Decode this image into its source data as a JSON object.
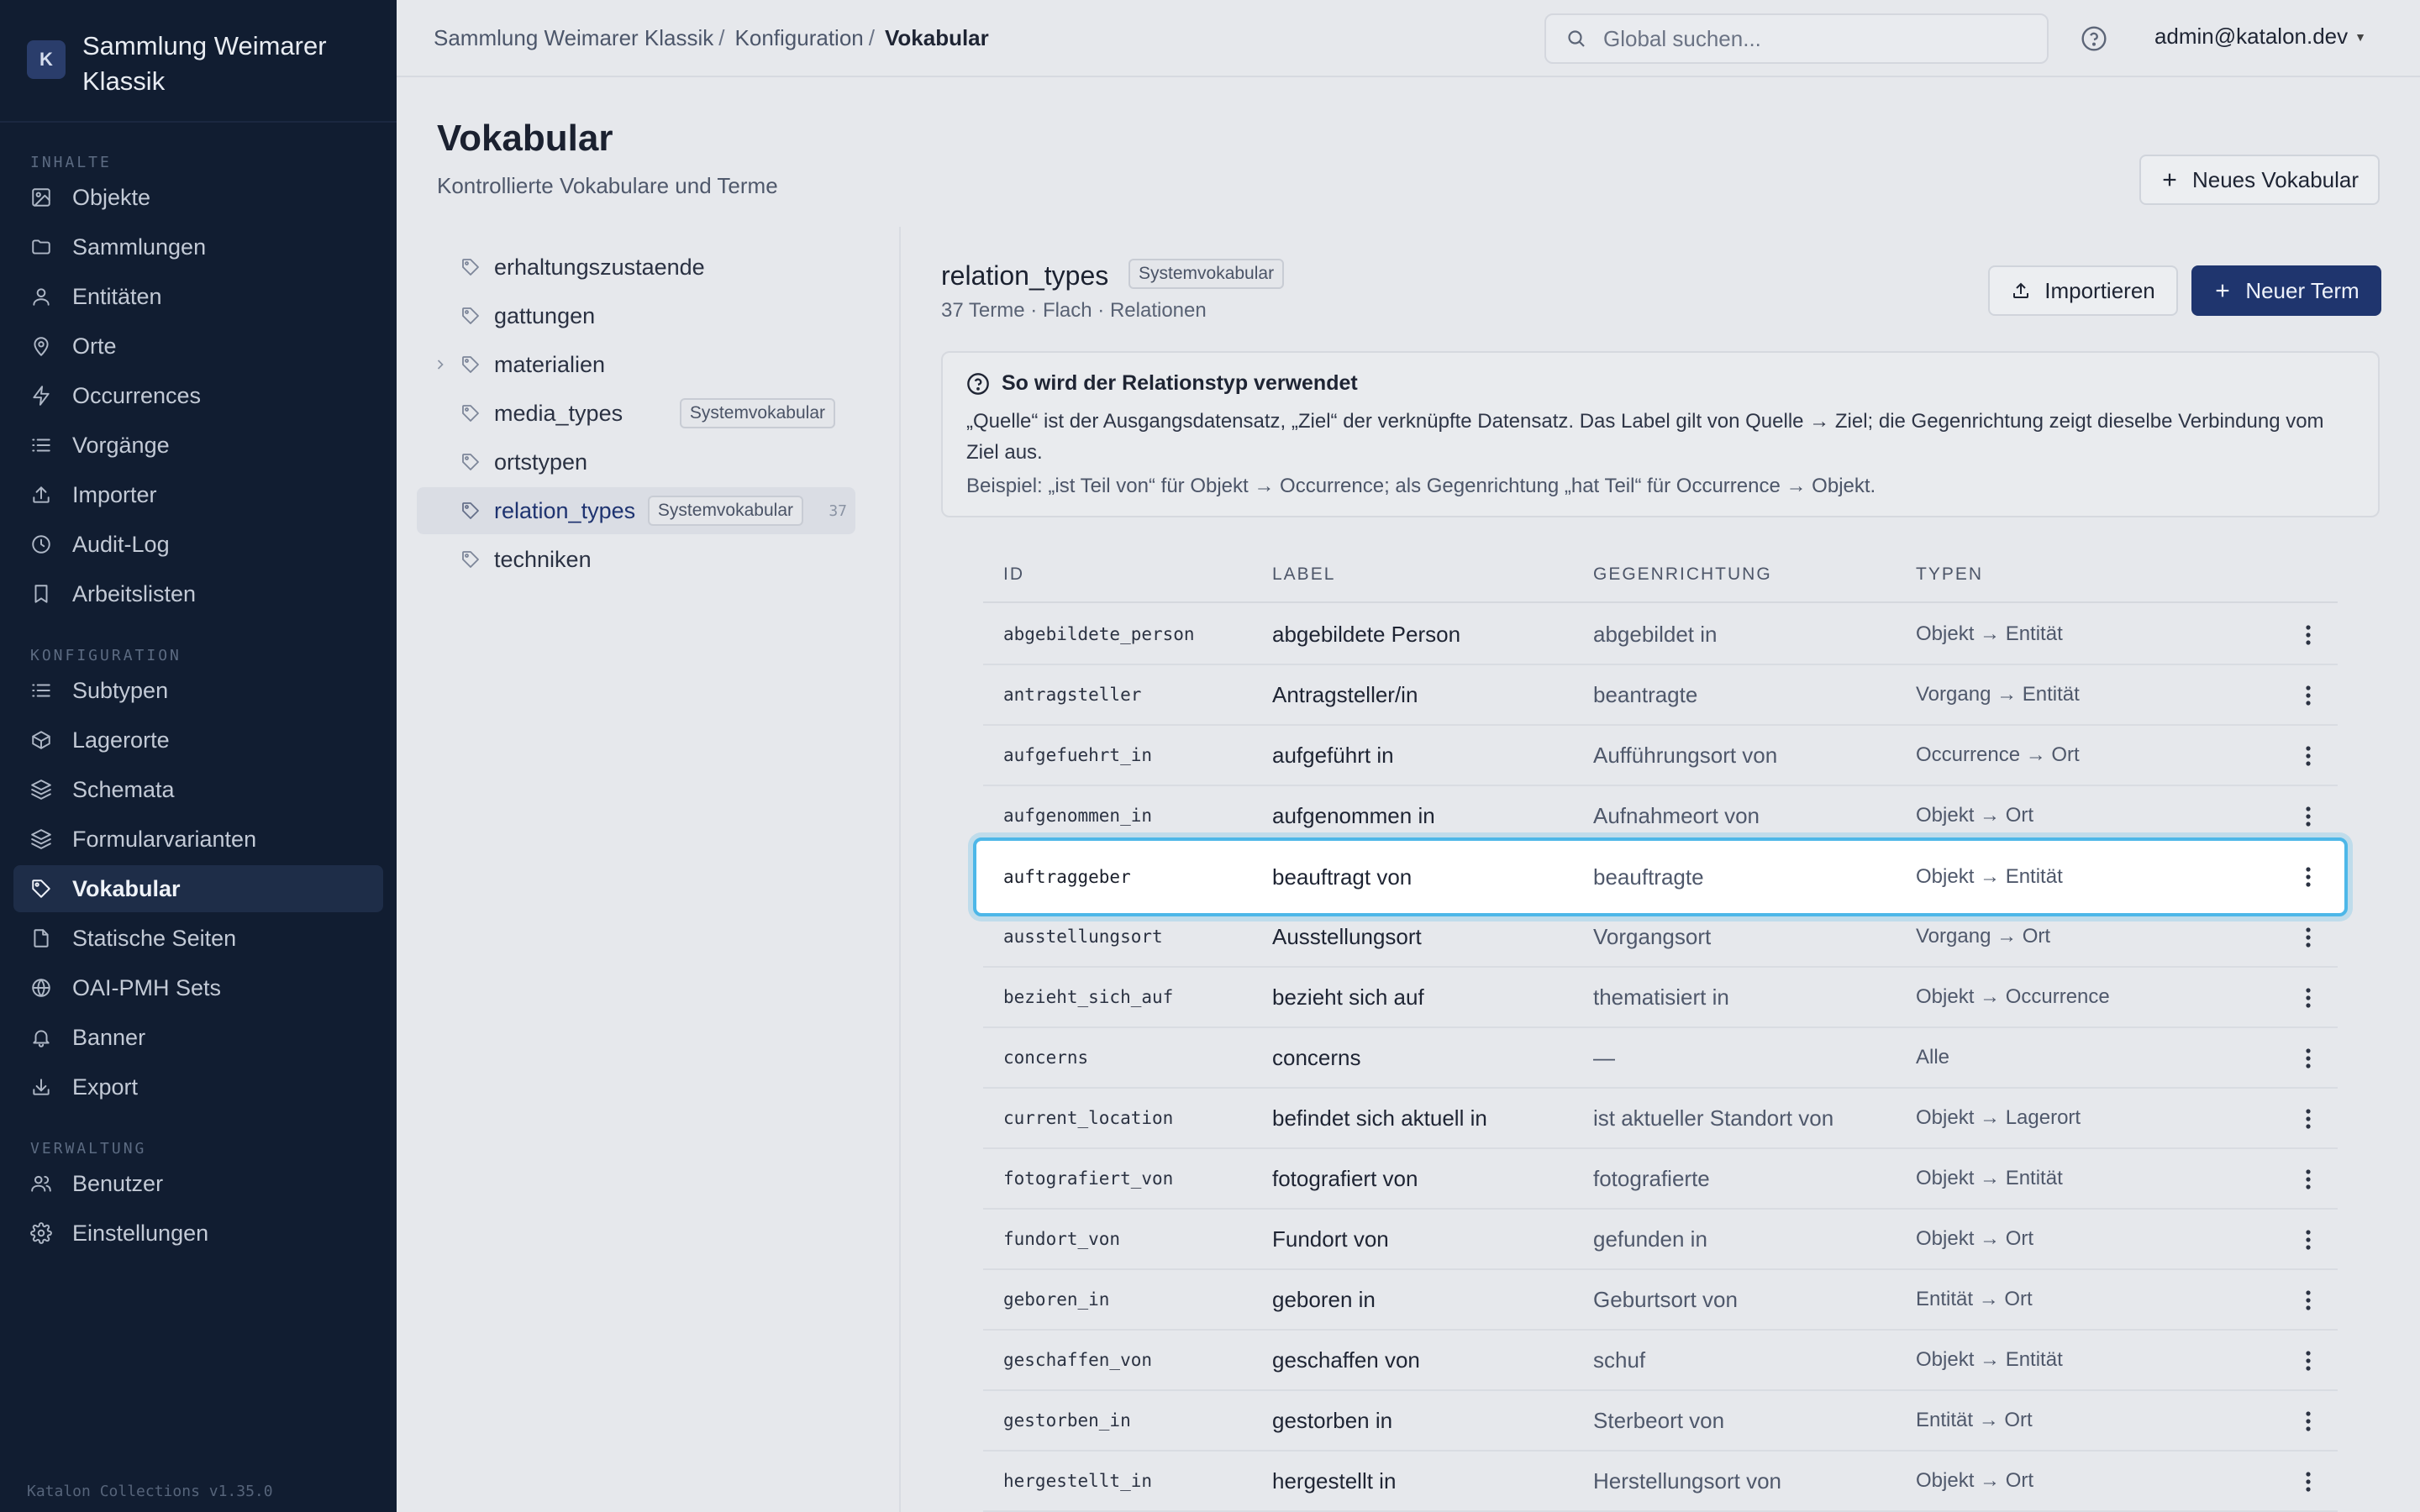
{
  "app": {
    "brand_initial": "K",
    "brand_name": "Sammlung Weimarer Klassik",
    "version": "Katalon Collections v1.35.0"
  },
  "sidebar": {
    "sections": [
      {
        "heading": "INHALTE",
        "items": [
          {
            "label": "Objekte",
            "icon": "image-icon"
          },
          {
            "label": "Sammlungen",
            "icon": "folder-icon"
          },
          {
            "label": "Entitäten",
            "icon": "person-icon"
          },
          {
            "label": "Orte",
            "icon": "map-pin-icon"
          },
          {
            "label": "Occurrences",
            "icon": "bolt-icon"
          },
          {
            "label": "Vorgänge",
            "icon": "list-icon"
          },
          {
            "label": "Importer",
            "icon": "upload-icon"
          },
          {
            "label": "Audit-Log",
            "icon": "clock-icon"
          },
          {
            "label": "Arbeitslisten",
            "icon": "bookmark-icon"
          }
        ]
      },
      {
        "heading": "KONFIGURATION",
        "items": [
          {
            "label": "Subtypen",
            "icon": "list-icon"
          },
          {
            "label": "Lagerorte",
            "icon": "box-icon"
          },
          {
            "label": "Schemata",
            "icon": "layers-icon"
          },
          {
            "label": "Formularvarianten",
            "icon": "layers-icon"
          },
          {
            "label": "Vokabular",
            "icon": "tag-icon",
            "active": true
          },
          {
            "label": "Statische Seiten",
            "icon": "file-icon"
          },
          {
            "label": "OAI-PMH Sets",
            "icon": "globe-icon"
          },
          {
            "label": "Banner",
            "icon": "bell-icon"
          },
          {
            "label": "Export",
            "icon": "download-icon"
          }
        ]
      },
      {
        "heading": "VERWALTUNG",
        "items": [
          {
            "label": "Benutzer",
            "icon": "users-icon"
          },
          {
            "label": "Einstellungen",
            "icon": "gear-icon"
          }
        ]
      }
    ]
  },
  "topbar": {
    "breadcrumbs": [
      "Sammlung Weimarer Klassik",
      "Konfiguration",
      "Vokabular"
    ],
    "search_placeholder": "Global suchen...",
    "user": "admin@katalon.dev"
  },
  "page": {
    "title": "Vokabular",
    "subtitle": "Kontrollierte Vokabulare und Terme",
    "new_vocab_label": "Neues Vokabular"
  },
  "vocab_list": [
    {
      "name": "erhaltungszustaende"
    },
    {
      "name": "gattungen"
    },
    {
      "name": "materialien",
      "expandable": true
    },
    {
      "name": "media_types",
      "badge": "Systemvokabular"
    },
    {
      "name": "ortstypen"
    },
    {
      "name": "relation_types",
      "badge": "Systemvokabular",
      "count": "37",
      "active": true
    },
    {
      "name": "techniken"
    }
  ],
  "detail": {
    "name": "relation_types",
    "badge": "Systemvokabular",
    "meta": "37 Terme · Flach · Relationen",
    "import_label": "Importieren",
    "new_term_label": "Neuer Term",
    "info": {
      "title": "So wird der Relationstyp verwendet",
      "text": "„Quelle“ ist der Ausgangsdatensatz, „Ziel“ der verknüpfte Datensatz. Das Label gilt von Quelle → Ziel; die Gegenrichtung zeigt dieselbe Verbindung vom Ziel aus.",
      "example": "Beispiel: „ist Teil von“ für Objekt → Occurrence; als Gegenrichtung „hat Teil“ für Occurrence → Objekt."
    }
  },
  "table": {
    "columns": [
      "ID",
      "LABEL",
      "GEGENRICHTUNG",
      "TYPEN"
    ],
    "rows": [
      {
        "id": "abgebildete_person",
        "label": "abgebildete Person",
        "inverse": "abgebildet in",
        "types": "Objekt → Entität"
      },
      {
        "id": "antragsteller",
        "label": "Antragsteller/in",
        "inverse": "beantragte",
        "types": "Vorgang → Entität"
      },
      {
        "id": "aufgefuehrt_in",
        "label": "aufgeführt in",
        "inverse": "Aufführungsort von",
        "types": "Occurrence → Ort"
      },
      {
        "id": "aufgenommen_in",
        "label": "aufgenommen in",
        "inverse": "Aufnahmeort von",
        "types": "Objekt → Ort"
      },
      {
        "id": "auftraggeber",
        "label": "beauftragt von",
        "inverse": "beauftragte",
        "types": "Objekt → Entität",
        "selected": true
      },
      {
        "id": "ausstellungsort",
        "label": "Ausstellungsort",
        "inverse": "Vorgangsort",
        "types": "Vorgang → Ort"
      },
      {
        "id": "bezieht_sich_auf",
        "label": "bezieht sich auf",
        "inverse": "thematisiert in",
        "types": "Objekt → Occurrence"
      },
      {
        "id": "concerns",
        "label": "concerns",
        "inverse": "—",
        "types": "Alle"
      },
      {
        "id": "current_location",
        "label": "befindet sich aktuell in",
        "inverse": "ist aktueller Standort von",
        "types": "Objekt → Lagerort"
      },
      {
        "id": "fotografiert_von",
        "label": "fotografiert von",
        "inverse": "fotografierte",
        "types": "Objekt → Entität"
      },
      {
        "id": "fundort_von",
        "label": "Fundort von",
        "inverse": "gefunden in",
        "types": "Objekt → Ort"
      },
      {
        "id": "geboren_in",
        "label": "geboren in",
        "inverse": "Geburtsort von",
        "types": "Entität → Ort"
      },
      {
        "id": "geschaffen_von",
        "label": "geschaffen von",
        "inverse": "schuf",
        "types": "Objekt → Entität"
      },
      {
        "id": "gestorben_in",
        "label": "gestorben in",
        "inverse": "Sterbeort von",
        "types": "Entität → Ort"
      },
      {
        "id": "hergestellt_in",
        "label": "hergestellt in",
        "inverse": "Herstellungsort von",
        "types": "Objekt → Ort"
      }
    ]
  }
}
